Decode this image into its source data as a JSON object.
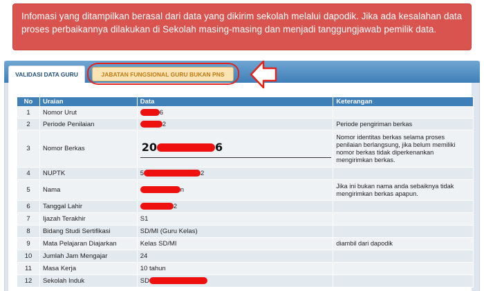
{
  "alert": {
    "message": "Infomasi yang ditampilkan berasal dari data yang dikirim sekolah melalui dapodik. Jika ada kesalahan data proses perbaikannya dilakukan di Sekolah masing-masing dan menjadi tanggungjawab pemilik data.",
    "color": "#d9534f"
  },
  "tabs": [
    {
      "label": "VALIDASI DATA GURU",
      "active": true
    },
    {
      "label": "JABATAN FUNGSIONAL GURU BUKAN PNS",
      "active": false
    }
  ],
  "table": {
    "headers": {
      "no": "No",
      "uraian": "Uraian",
      "data": "Data",
      "keterangan": "Keterangan"
    },
    "rows": [
      {
        "no": "1",
        "uraian": "Nomor Urut",
        "data_prefix": "",
        "data_suffix": "6",
        "redacted": true,
        "keterangan": ""
      },
      {
        "no": "2",
        "uraian": "Periode Penilaian",
        "data_prefix": "",
        "data_suffix": "2",
        "redacted": true,
        "keterangan": "Periode pengiriman berkas"
      },
      {
        "no": "3",
        "uraian": "Nomor Berkas",
        "data_prefix": "20",
        "data_suffix": "6",
        "redacted": true,
        "keterangan": "Nomor identitas berkas selama proses penilaian berlangsung, jika belum memiliki nomor berkas tidak diperkenankan mengirimkan berkas."
      },
      {
        "no": "4",
        "uraian": "NUPTK",
        "data_prefix": "5",
        "data_suffix": "2",
        "redacted": true,
        "keterangan": ""
      },
      {
        "no": "5",
        "uraian": "Nama",
        "data_prefix": "",
        "data_suffix": "n",
        "redacted": true,
        "keterangan": "Jika ini bukan nama anda sebaiknya tidak mengirimkan berkas apapun."
      },
      {
        "no": "6",
        "uraian": "Tanggal Lahir",
        "data_prefix": "",
        "data_suffix": "2",
        "redacted": true,
        "keterangan": ""
      },
      {
        "no": "7",
        "uraian": "Ijazah Terakhir",
        "data_prefix": "S1",
        "data_suffix": "",
        "redacted": false,
        "keterangan": ""
      },
      {
        "no": "8",
        "uraian": "Bidang Studi Sertifikasi",
        "data_prefix": "SD/MI (Guru Kelas)",
        "data_suffix": "",
        "redacted": false,
        "keterangan": ""
      },
      {
        "no": "9",
        "uraian": "Mata Pelajaran Diajarkan",
        "data_prefix": "Kelas SD/MI",
        "data_suffix": "",
        "redacted": false,
        "keterangan": "diambil dari dapodik"
      },
      {
        "no": "10",
        "uraian": "Jumlah Jam Mengajar",
        "data_prefix": "24",
        "data_suffix": "",
        "redacted": false,
        "keterangan": ""
      },
      {
        "no": "11",
        "uraian": "Masa Kerja",
        "data_prefix": "10 tahun",
        "data_suffix": "",
        "redacted": false,
        "keterangan": ""
      },
      {
        "no": "12",
        "uraian": "Sekolah Induk",
        "data_prefix": "SD",
        "data_suffix": "",
        "redacted": true,
        "keterangan": ""
      }
    ]
  },
  "colors": {
    "header_blue": "#3f7fb8",
    "tab_orange": "#c27a12",
    "annotation_red": "#e4221b",
    "redaction_red": "#ee0f0f"
  }
}
